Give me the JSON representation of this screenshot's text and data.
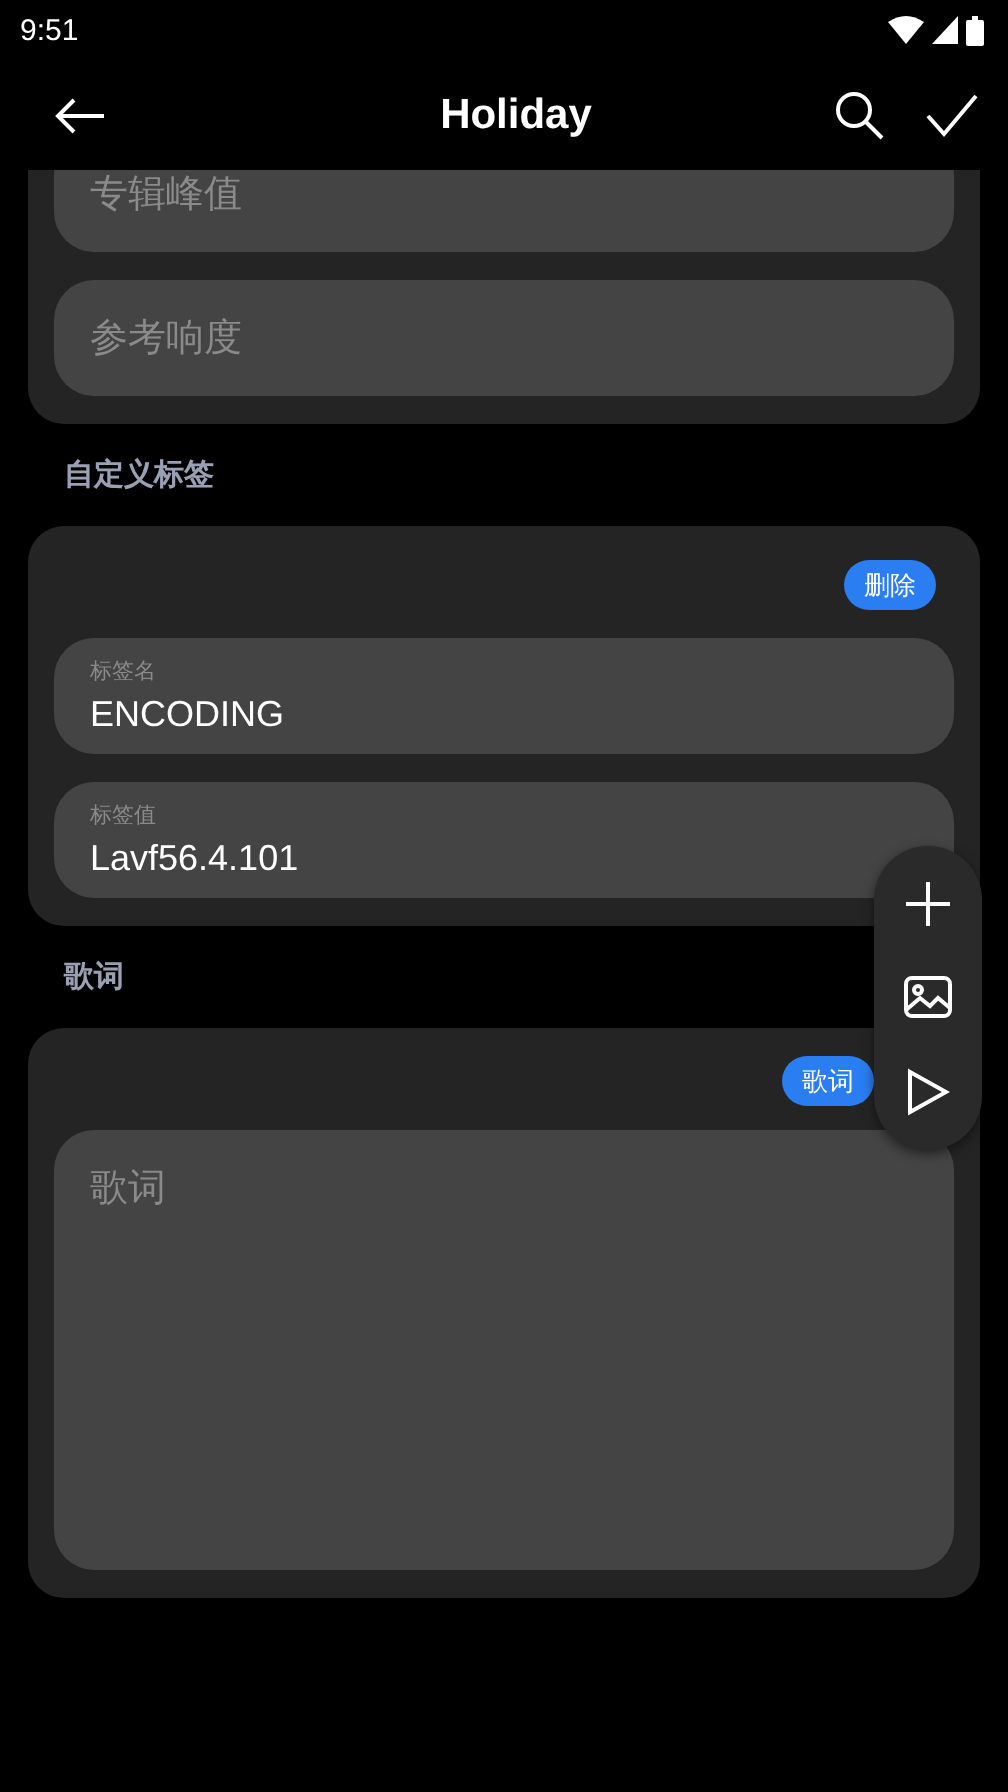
{
  "status_bar": {
    "time": "9:51"
  },
  "toolbar": {
    "title": "Holiday"
  },
  "loudness_card": {
    "fields": [
      {
        "placeholder": "专辑峰值"
      },
      {
        "placeholder": "参考响度"
      }
    ]
  },
  "custom_tags": {
    "heading": "自定义标签",
    "delete_button": "删除",
    "fields": [
      {
        "label": "标签名",
        "value": "ENCODING"
      },
      {
        "label": "标签值",
        "value": "Lavf56.4.101"
      }
    ]
  },
  "lyrics": {
    "heading": "歌词",
    "button": "歌词",
    "placeholder": "歌词"
  }
}
